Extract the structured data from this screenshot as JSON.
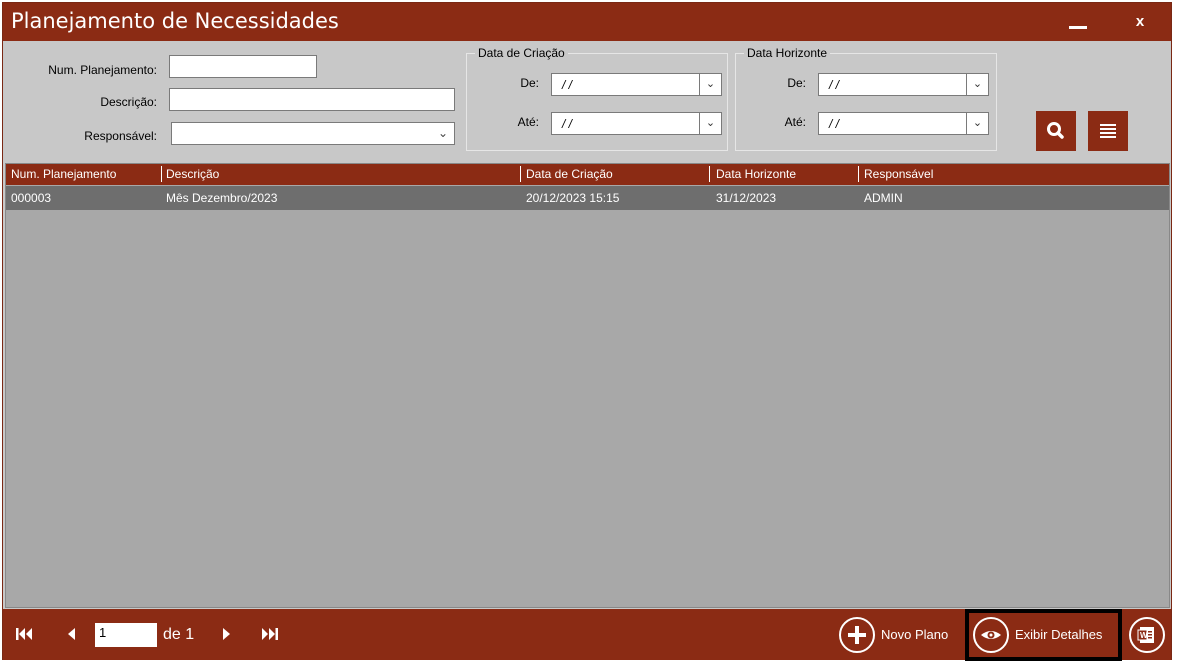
{
  "window": {
    "title": "Planejamento de Necessidades",
    "close_label": "x"
  },
  "filters": {
    "num_planejamento_label": "Num. Planejamento:",
    "num_planejamento_value": "",
    "descricao_label": "Descrição:",
    "descricao_value": "",
    "responsavel_label": "Responsável:",
    "responsavel_value": "",
    "data_criacao": {
      "title": "Data de Criação",
      "de_label": "De:",
      "de_value": "/ /",
      "ate_label": "Até:",
      "ate_value": "/ /"
    },
    "data_horizonte": {
      "title": "Data Horizonte",
      "de_label": "De:",
      "de_value": "/ /",
      "ate_label": "Até:",
      "ate_value": "/ /"
    },
    "search_icon": "search-icon",
    "menu_icon": "list-icon"
  },
  "grid": {
    "columns": [
      "Num. Planejamento",
      "Descrição",
      "Data de Criação",
      "Data Horizonte",
      "Responsável"
    ],
    "rows": [
      [
        "000003",
        "Mês Dezembro/2023",
        "20/12/2023 15:15",
        "31/12/2023",
        "ADMIN"
      ]
    ]
  },
  "footer": {
    "page_value": "1",
    "of_label": "de 1",
    "novo_plano_label": "Novo Plano",
    "exibir_detalhes_label": "Exibir Detalhes"
  },
  "colors": {
    "accent": "#8b2b14",
    "background": "#c8c8c8",
    "grid_background": "#a8a8a8",
    "selected_row": "#6e6e6e"
  }
}
